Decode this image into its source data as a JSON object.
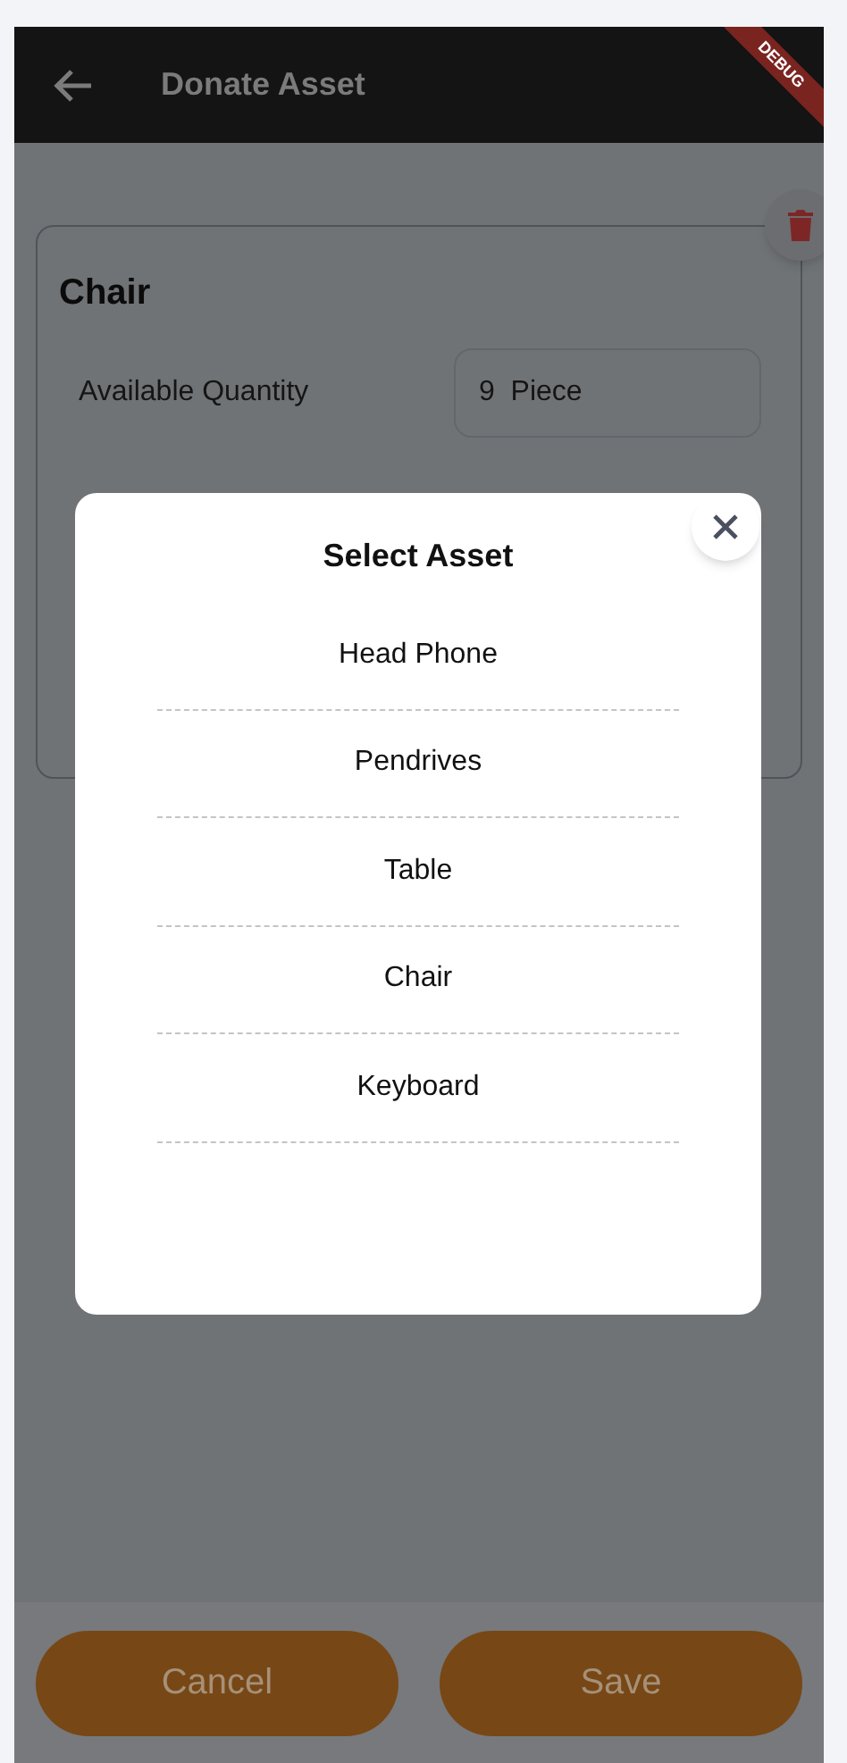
{
  "app_bar": {
    "title": "Donate Asset",
    "debug_banner": "DEBUG"
  },
  "asset_card": {
    "name": "Chair",
    "quantity_label": "Available Quantity",
    "quantity_value": "9  Piece"
  },
  "dialog": {
    "title": "Select Asset",
    "options": [
      {
        "label": "Head Phone"
      },
      {
        "label": "Pendrives"
      },
      {
        "label": "Table"
      },
      {
        "label": "Chair"
      },
      {
        "label": "Keyboard"
      }
    ]
  },
  "buttons": [
    {
      "label": "Cancel"
    },
    {
      "label": "Save"
    }
  ]
}
